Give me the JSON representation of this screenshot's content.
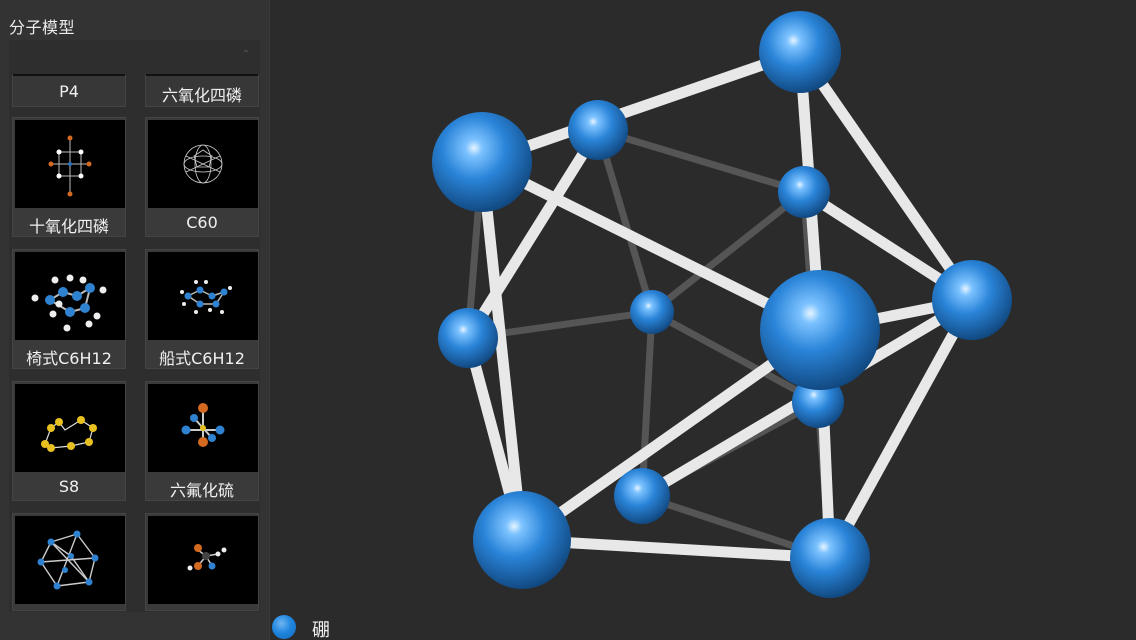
{
  "sidebar": {
    "title": "分子模型",
    "items": [
      {
        "label": "P4",
        "thumb_icon": "p4-thumbnail"
      },
      {
        "label": "六氧化四磷",
        "thumb_icon": "p4o6-thumbnail"
      },
      {
        "label": "十氧化四磷",
        "thumb_icon": "p4o10-thumbnail"
      },
      {
        "label": "C60",
        "thumb_icon": "c60-thumbnail"
      },
      {
        "label": "椅式C6H12",
        "thumb_icon": "chair-cyclohexane-thumbnail"
      },
      {
        "label": "船式C6H12",
        "thumb_icon": "boat-cyclohexane-thumbnail"
      },
      {
        "label": "S8",
        "thumb_icon": "s8-thumbnail"
      },
      {
        "label": "六氟化硫",
        "thumb_icon": "sf6-thumbnail"
      },
      {
        "label": "",
        "thumb_icon": "b12-thumbnail"
      },
      {
        "label": "",
        "thumb_icon": "small-molecule-thumbnail"
      }
    ]
  },
  "legend": {
    "element_label": "硼",
    "color": "#1f86e0"
  },
  "colors": {
    "background": "#2b2b2b",
    "sidebar": "#333333",
    "atom_blue": "#1f86e0",
    "bond_white": "#e6e6e6"
  }
}
